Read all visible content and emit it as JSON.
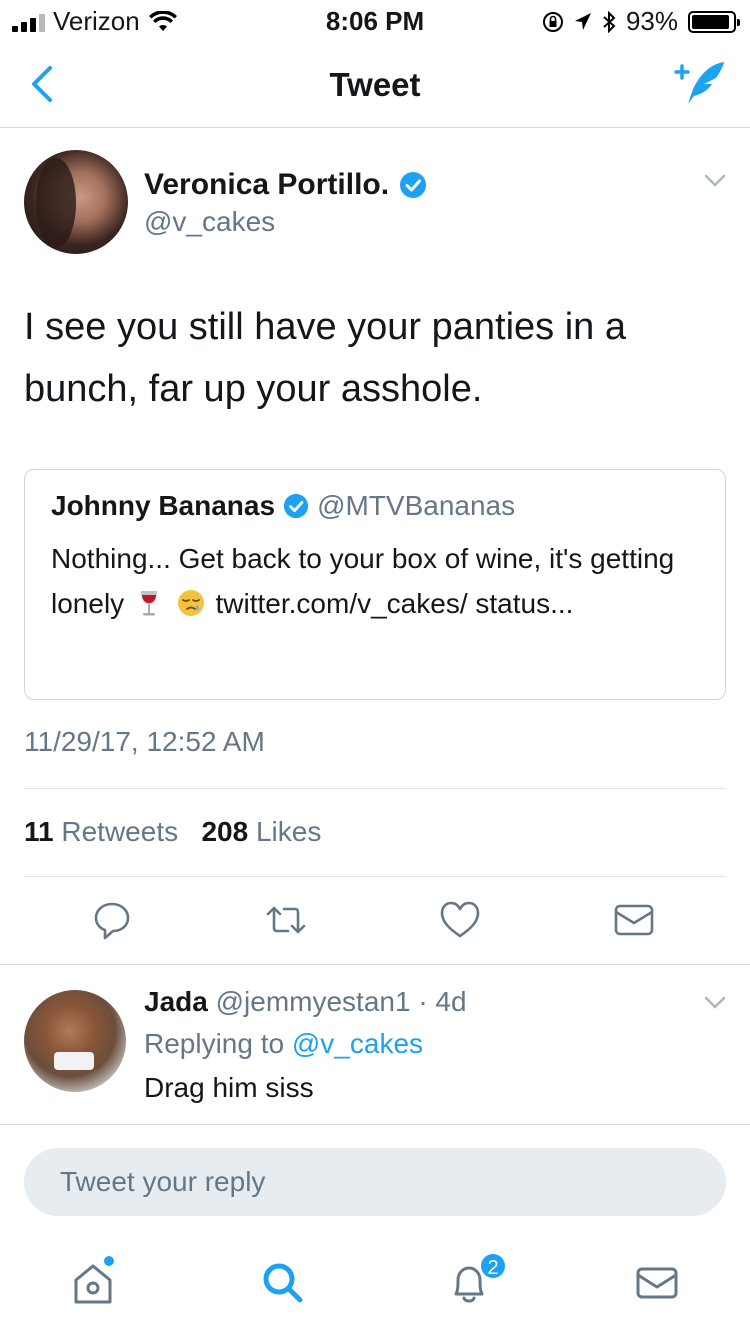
{
  "status_bar": {
    "carrier": "Verizon",
    "time": "8:06 PM",
    "battery": "93%",
    "battery_level": 0.93,
    "signal_bars_filled": 3,
    "icons": [
      "wifi-icon",
      "orientation-lock-icon",
      "location-icon",
      "bluetooth-icon",
      "battery-icon"
    ]
  },
  "nav": {
    "title": "Tweet",
    "back_icon": "chevron-left-icon",
    "compose_icon": "compose-tweet-icon"
  },
  "tweet": {
    "author_name": "Veronica Portillo.",
    "author_handle": "@v_cakes",
    "verified": true,
    "text": "I see you still have your panties in a bunch, far up your asshole.",
    "quoted": {
      "author_name": "Johnny Bananas",
      "author_handle": "@MTVBananas",
      "verified": true,
      "text_part1": "Nothing... Get back to your box of wine, it's getting lonely",
      "emojis": [
        "wine-glass-icon",
        "sleepy-face-icon"
      ],
      "text_part2": "twitter.com/v_cakes/ status..."
    },
    "timestamp": "11/29/17, 12:52 AM",
    "retweets_count": "11",
    "retweets_label": "Retweets",
    "likes_count": "208",
    "likes_label": "Likes",
    "actions": [
      "reply-icon",
      "retweet-icon",
      "like-icon",
      "message-icon"
    ]
  },
  "reply": {
    "author_name": "Jada",
    "author_handle": "@jemmyestan1",
    "age": "· 4d",
    "replying_prefix": "Replying to",
    "replying_to": "@v_cakes",
    "text": "Drag him siss"
  },
  "reply_box": {
    "placeholder": "Tweet your reply"
  },
  "tabbar": {
    "tabs": [
      "home-icon",
      "search-icon",
      "notifications-icon",
      "messages-icon"
    ],
    "notifications_badge": "2",
    "accent_color": "#1da1f2"
  },
  "colors": {
    "accent": "#1da1f2",
    "secondary_text": "#657786",
    "primary_text": "#14171a",
    "divider": "#e1e8ed"
  }
}
